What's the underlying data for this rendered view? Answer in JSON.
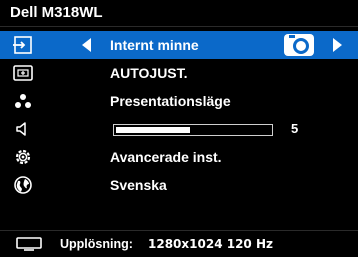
{
  "window": {
    "title": "Dell M318WL"
  },
  "accent_color": "#0b69c9",
  "menu": {
    "items": [
      {
        "icon": "input-source-icon",
        "label": "Internt minne",
        "selected": true,
        "source_icon": "camera-icon"
      },
      {
        "icon": "auto-adjust-icon",
        "label": "AUTOJUST."
      },
      {
        "icon": "presentation-mode-icon",
        "label": "Presentationsläge"
      },
      {
        "icon": "volume-icon",
        "slider_value": "5",
        "slider_level_percent": 48
      },
      {
        "icon": "settings-gear-icon",
        "label": "Avancerade inst."
      },
      {
        "icon": "language-globe-icon",
        "label": "Svenska"
      }
    ]
  },
  "status": {
    "icon": "display-icon",
    "label": "Upplösning:",
    "value": "1280x1024 120 Hz"
  }
}
